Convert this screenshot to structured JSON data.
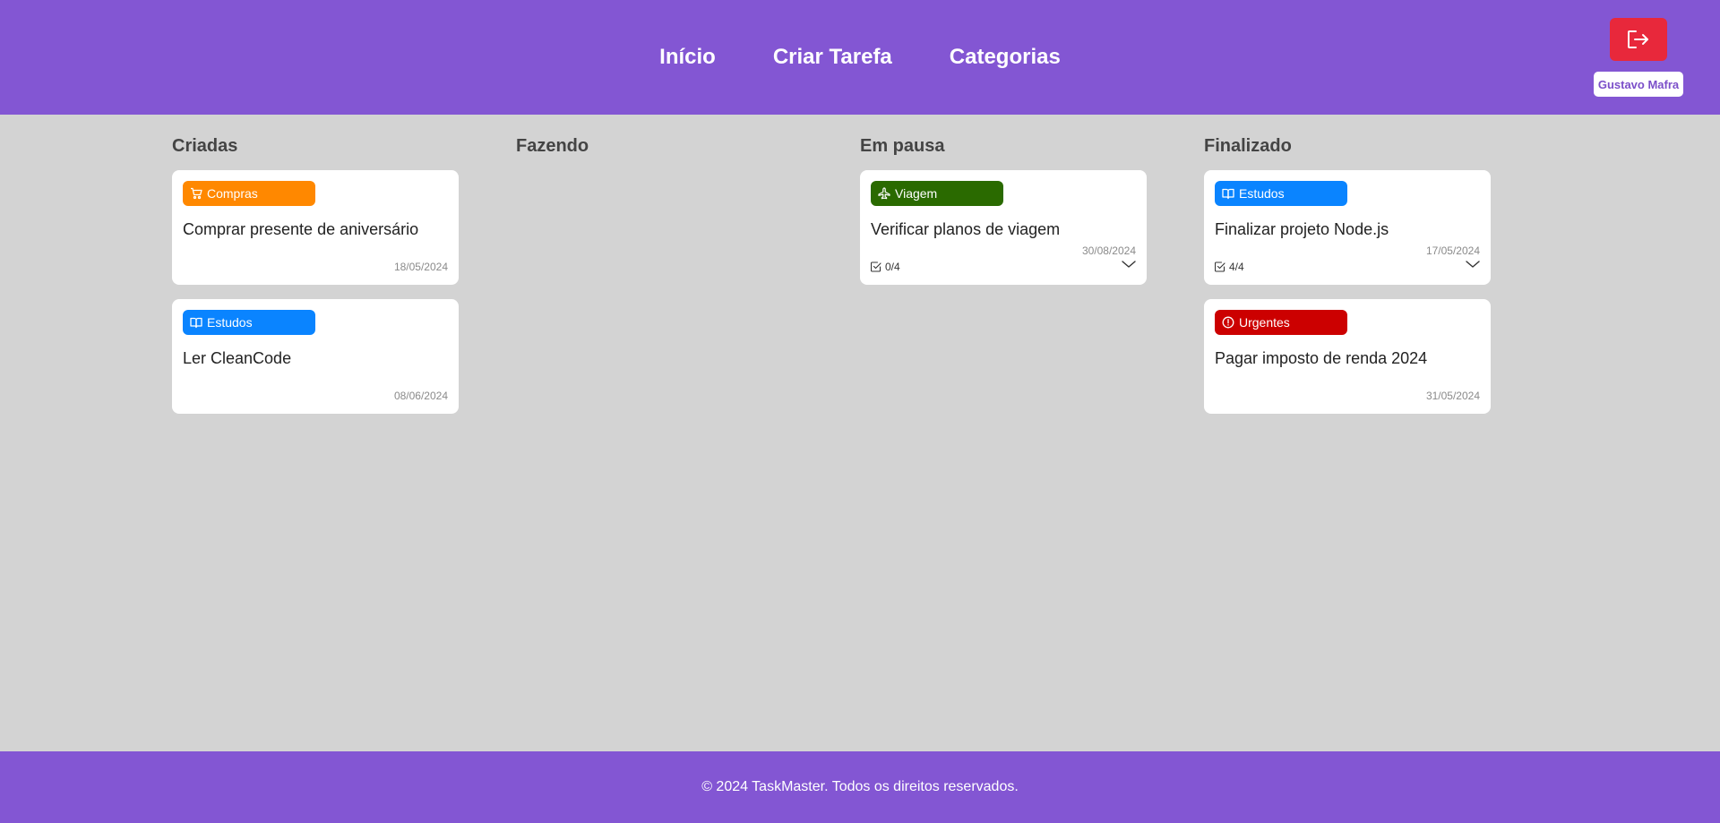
{
  "nav": {
    "items": [
      {
        "label": "Início"
      },
      {
        "label": "Criar Tarefa"
      },
      {
        "label": "Categorias"
      }
    ]
  },
  "user": {
    "name": "Gustavo Mafra",
    "logout_icon": "logout-icon"
  },
  "colors": {
    "header": "#8356d3",
    "logout": "#e8283b",
    "compras": "#ff8800",
    "estudos": "#0a84ff",
    "viagem": "#2a6a00",
    "urgentes": "#cc0000"
  },
  "columns": [
    {
      "title": "Criadas",
      "cards": [
        {
          "tag": "Compras",
          "tag_icon": "cart-icon",
          "title": "Comprar presente de aniversário",
          "date": "18/05/2024"
        },
        {
          "tag": "Estudos",
          "tag_icon": "book-icon",
          "title": "Ler CleanCode",
          "date": "08/06/2024"
        }
      ]
    },
    {
      "title": "Fazendo",
      "cards": []
    },
    {
      "title": "Em pausa",
      "cards": [
        {
          "tag": "Viagem",
          "tag_icon": "plane-icon",
          "title": "Verificar planos de viagem",
          "date": "30/08/2024",
          "checklist": "0/4"
        }
      ]
    },
    {
      "title": "Finalizado",
      "cards": [
        {
          "tag": "Estudos",
          "tag_icon": "book-icon",
          "title": "Finalizar projeto Node.js",
          "date": "17/05/2024",
          "checklist": "4/4"
        },
        {
          "tag": "Urgentes",
          "tag_icon": "alert-icon",
          "title": "Pagar imposto de renda 2024",
          "date": "31/05/2024"
        }
      ]
    }
  ],
  "footer": {
    "text": "© 2024 TaskMaster. Todos os direitos reservados."
  }
}
